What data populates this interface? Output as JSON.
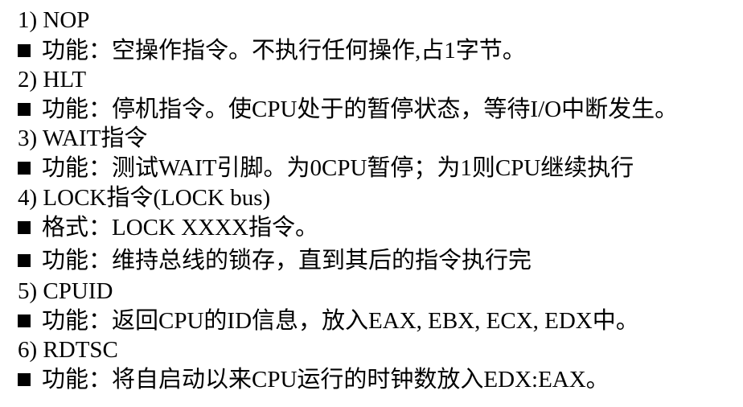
{
  "items": [
    {
      "heading": "1)  NOP",
      "bullets": [
        "功能：空操作指令。不执行任何操作,占1字节。"
      ]
    },
    {
      "heading": "2)  HLT",
      "bullets": [
        "功能：停机指令。使CPU处于的暂停状态，等待I/O中断发生。"
      ]
    },
    {
      "heading": "3)  WAIT指令",
      "bullets": [
        "功能：测试WAIT引脚。为0CPU暂停；为1则CPU继续执行"
      ]
    },
    {
      "heading": "4)  LOCK指令(LOCK bus)",
      "bullets": [
        "格式：LOCK XXXX指令。",
        "功能：维持总线的锁存，直到其后的指令执行完"
      ]
    },
    {
      "heading": "5) CPUID",
      "bullets": [
        "功能：返回CPU的ID信息，放入EAX, EBX, ECX, EDX中。"
      ]
    },
    {
      "heading": "6) RDTSC",
      "bullets": [
        "功能：将自启动以来CPU运行的时钟数放入EDX:EAX。"
      ]
    }
  ]
}
